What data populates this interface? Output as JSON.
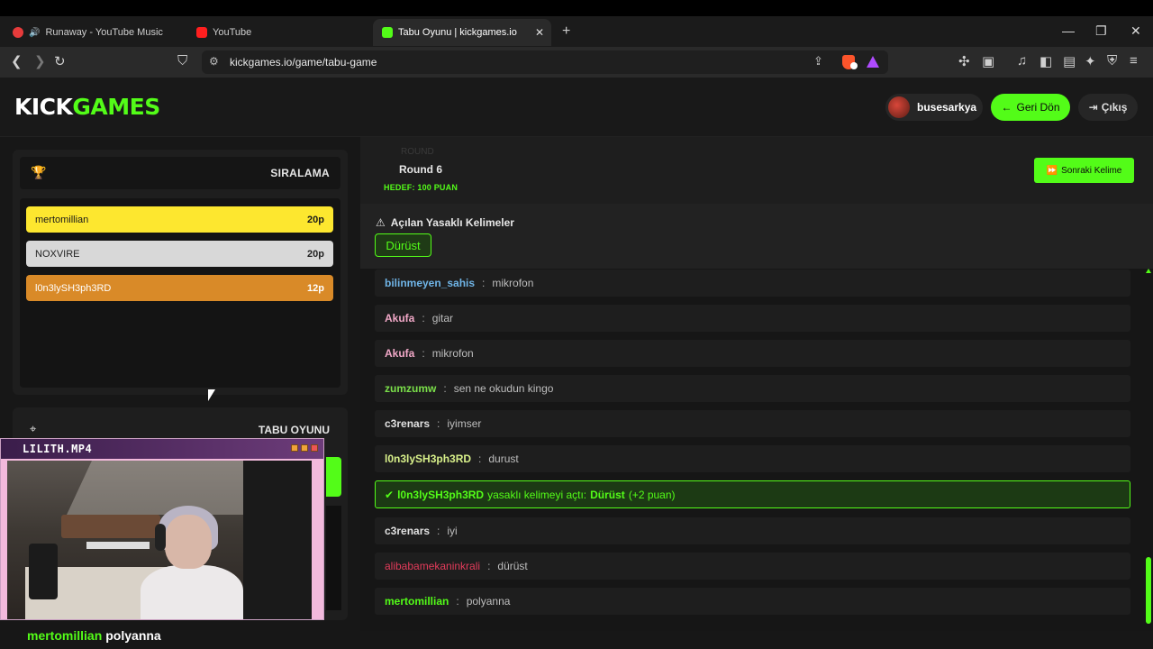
{
  "browser": {
    "tabs": [
      {
        "label": "Runaway - YouTube Music"
      },
      {
        "label": "YouTube"
      },
      {
        "label": "Tabu Oyunu | kickgames.io"
      }
    ],
    "url": "kickgames.io/game/tabu-game"
  },
  "header": {
    "logo_part1": "KICK",
    "logo_part2": "GAMES",
    "username": "busesarkya",
    "back_label": "Geri Dön",
    "exit_label": "Çıkış"
  },
  "ranking": {
    "title": "SIRALAMA",
    "rows": [
      {
        "name": "mertomillian",
        "points": "20p"
      },
      {
        "name": "NOXVIRE",
        "points": "20p"
      },
      {
        "name": "l0n3lySH3ph3RD",
        "points": "12p"
      }
    ]
  },
  "tabu": {
    "title": "TABU OYUNU"
  },
  "webcam": {
    "title": "LILITH.MP4"
  },
  "overlay_chat": {
    "user": "mertomillian",
    "message": "polyanna"
  },
  "round": {
    "faded": "ROUND",
    "title": "Round 6",
    "target": "HEDEF: 100 PUAN",
    "next_label": "Sonraki Kelime"
  },
  "banned": {
    "title": "Açılan Yasaklı Kelimeler",
    "words": [
      "Dürüst"
    ]
  },
  "chat": {
    "messages": [
      {
        "user": "bilinmeyen_sahis",
        "text": "mikrofon"
      },
      {
        "user": "Akufa",
        "text": "gitar"
      },
      {
        "user": "Akufa",
        "text": "mikrofon"
      },
      {
        "user": "zumzumw",
        "text": "sen ne okudun kingo"
      },
      {
        "user": "c3renars",
        "text": "iyimser"
      },
      {
        "user": "l0n3lySH3ph3RD",
        "text": "durust"
      },
      {
        "user": "c3renars",
        "text": "iyi"
      },
      {
        "user": "alibabamekaninkrali",
        "text": "dürüst"
      },
      {
        "user": "mertomillian",
        "text": "polyanna"
      }
    ],
    "system": {
      "user": "l0n3lySH3ph3RD",
      "middle": "yasaklı kelimeyi açtı:",
      "word": "Dürüst",
      "bonus": "(+2 puan)"
    }
  },
  "colors": {
    "accent": "#53fc18",
    "gold": "#fde72f",
    "silver": "#d8d8d8",
    "bronze": "#d98a28"
  }
}
